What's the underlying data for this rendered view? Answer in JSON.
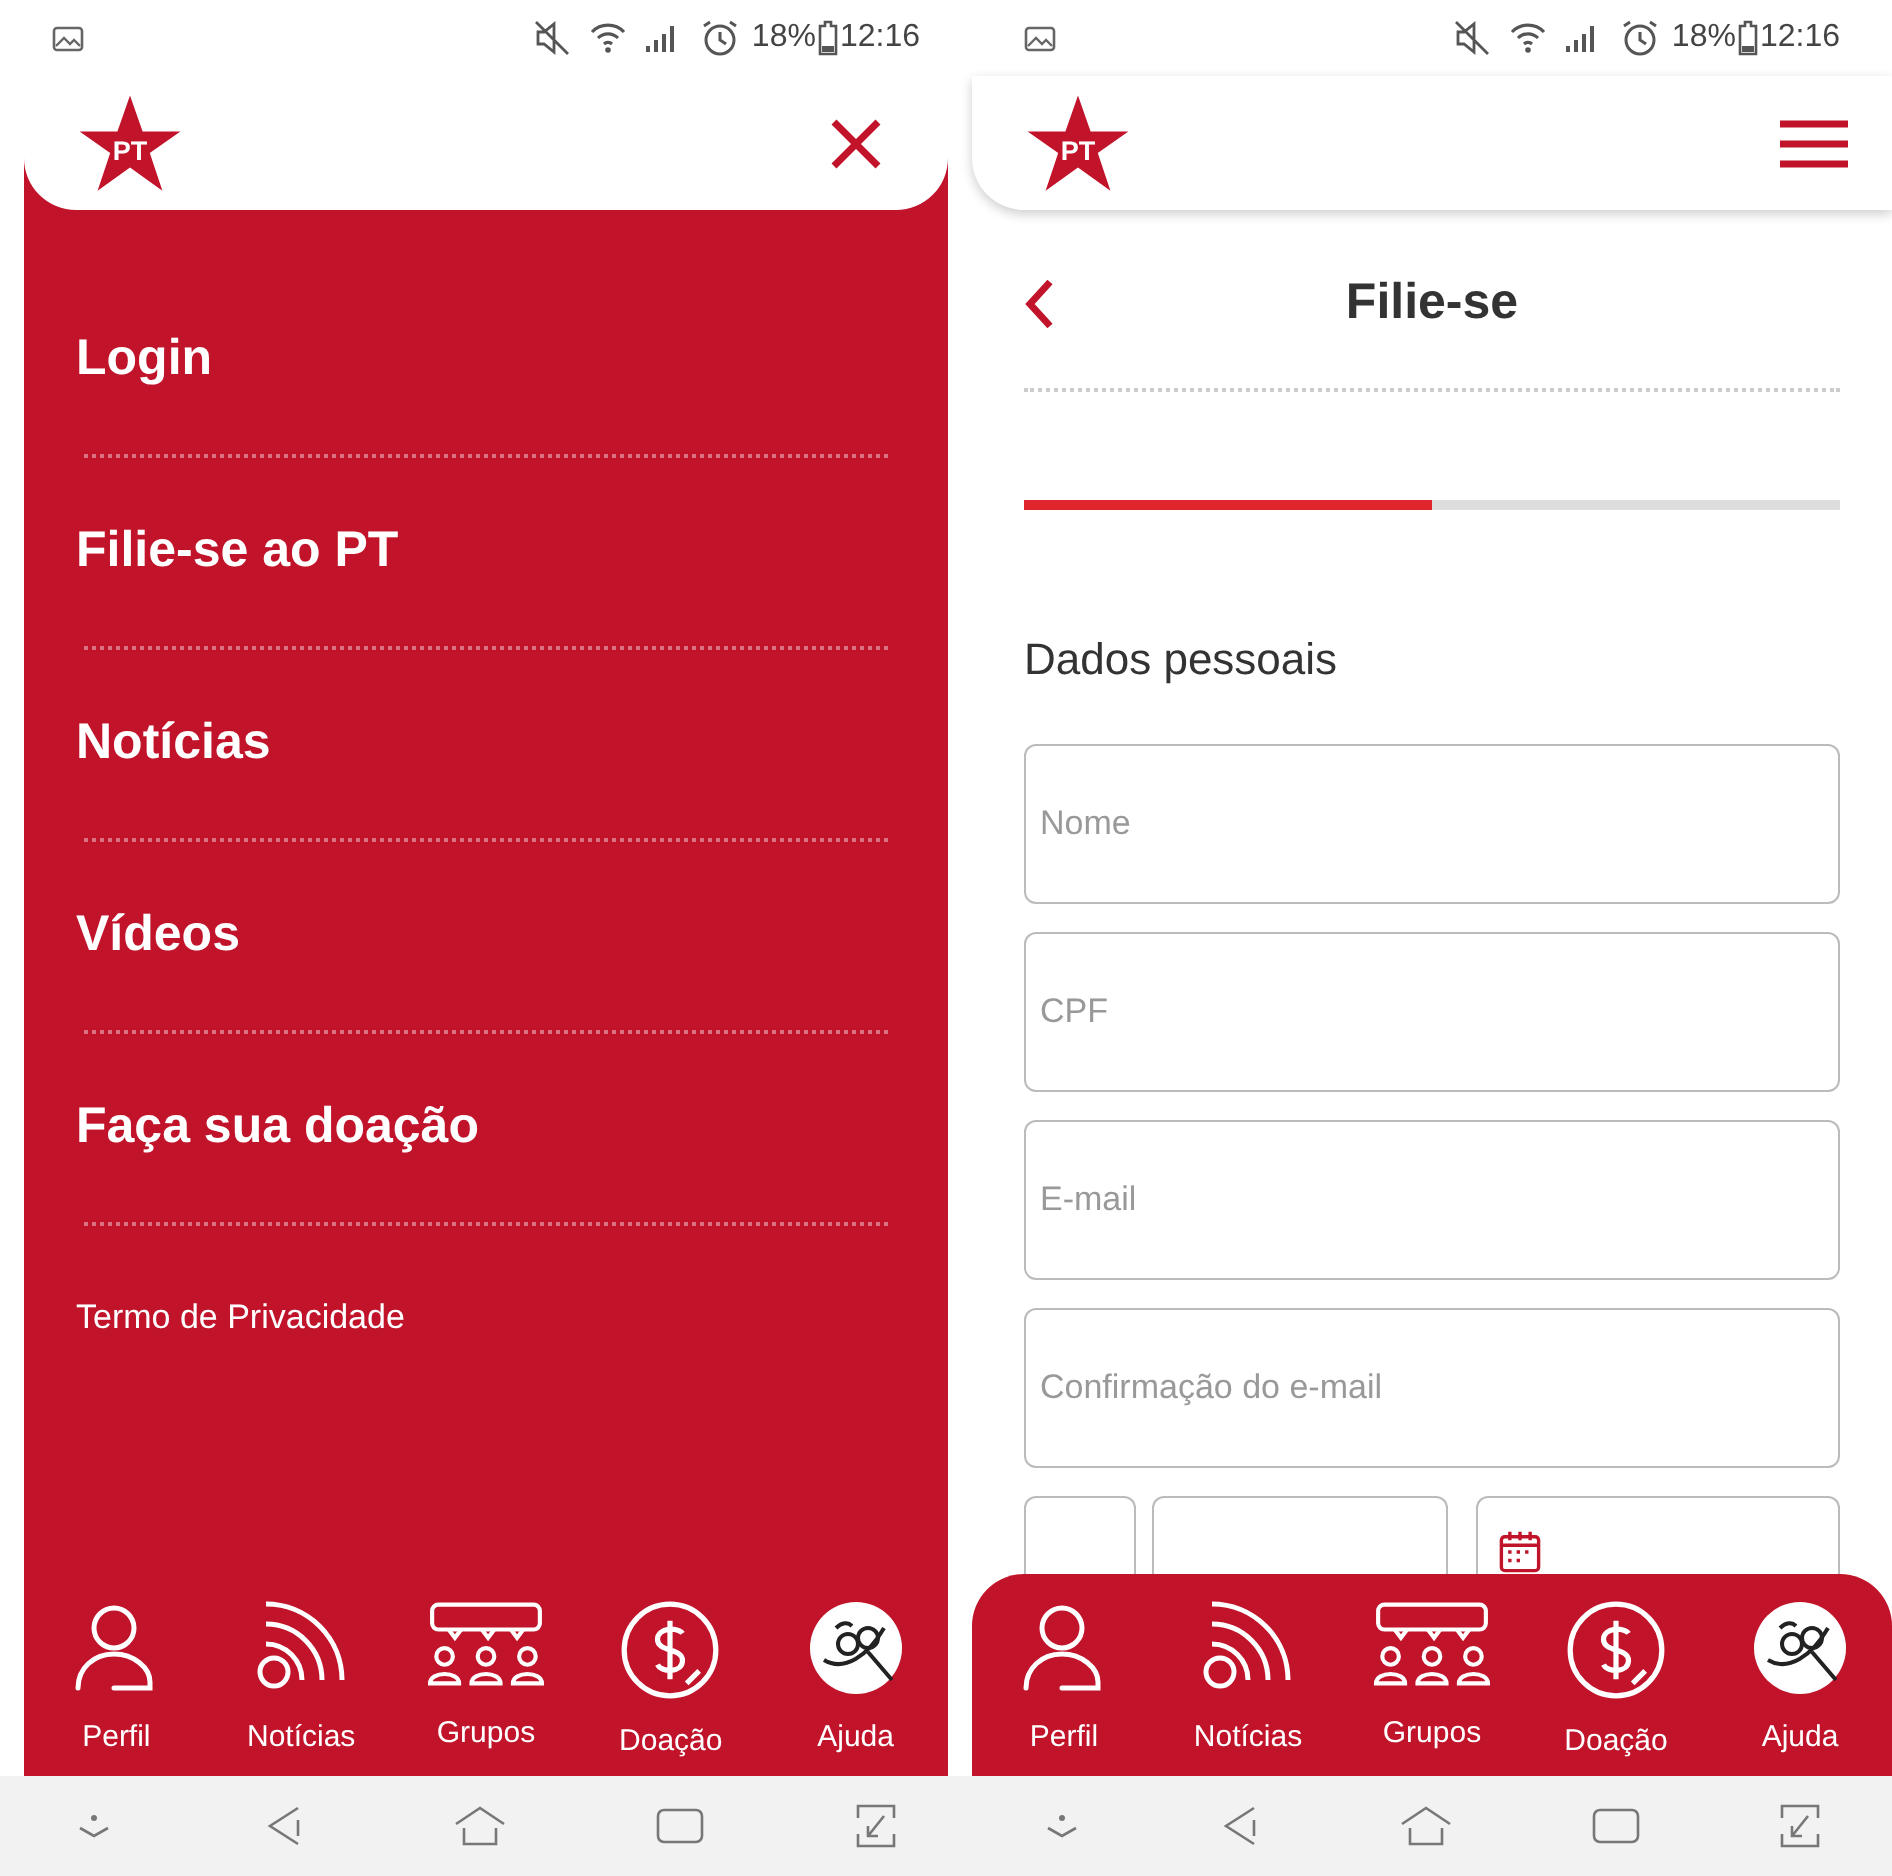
{
  "left_screen": {
    "status_bar": {
      "battery": "18%",
      "time": "12:16"
    },
    "logo_text": "PT",
    "menu": {
      "items": [
        {
          "label": "Login"
        },
        {
          "label": "Filie-se ao PT"
        },
        {
          "label": "Notícias"
        },
        {
          "label": "Vídeos"
        },
        {
          "label": "Faça sua doação"
        }
      ],
      "footer_link": "Termo de Privacidade"
    },
    "bottom_nav": [
      {
        "label": "Perfil"
      },
      {
        "label": "Notícias"
      },
      {
        "label": "Grupos"
      },
      {
        "label": "Doação"
      },
      {
        "label": "Ajuda"
      }
    ]
  },
  "right_screen": {
    "status_bar": {
      "battery": "18%",
      "time": "12:16"
    },
    "logo_text": "PT",
    "page_title": "Filie-se",
    "progress": {
      "level": 0.5
    },
    "section_title": "Dados pessoais",
    "fields": [
      {
        "placeholder": "Nome"
      },
      {
        "placeholder": "CPF"
      },
      {
        "placeholder": "E-mail"
      },
      {
        "placeholder": "Confirmação do e-mail"
      }
    ],
    "phone_row": [
      {
        "kind": "ddd"
      },
      {
        "kind": "phone"
      },
      {
        "kind": "date"
      }
    ],
    "bottom_nav": [
      {
        "label": "Perfil"
      },
      {
        "label": "Notícias"
      },
      {
        "label": "Grupos"
      },
      {
        "label": "Doação"
      },
      {
        "label": "Ajuda"
      }
    ]
  }
}
